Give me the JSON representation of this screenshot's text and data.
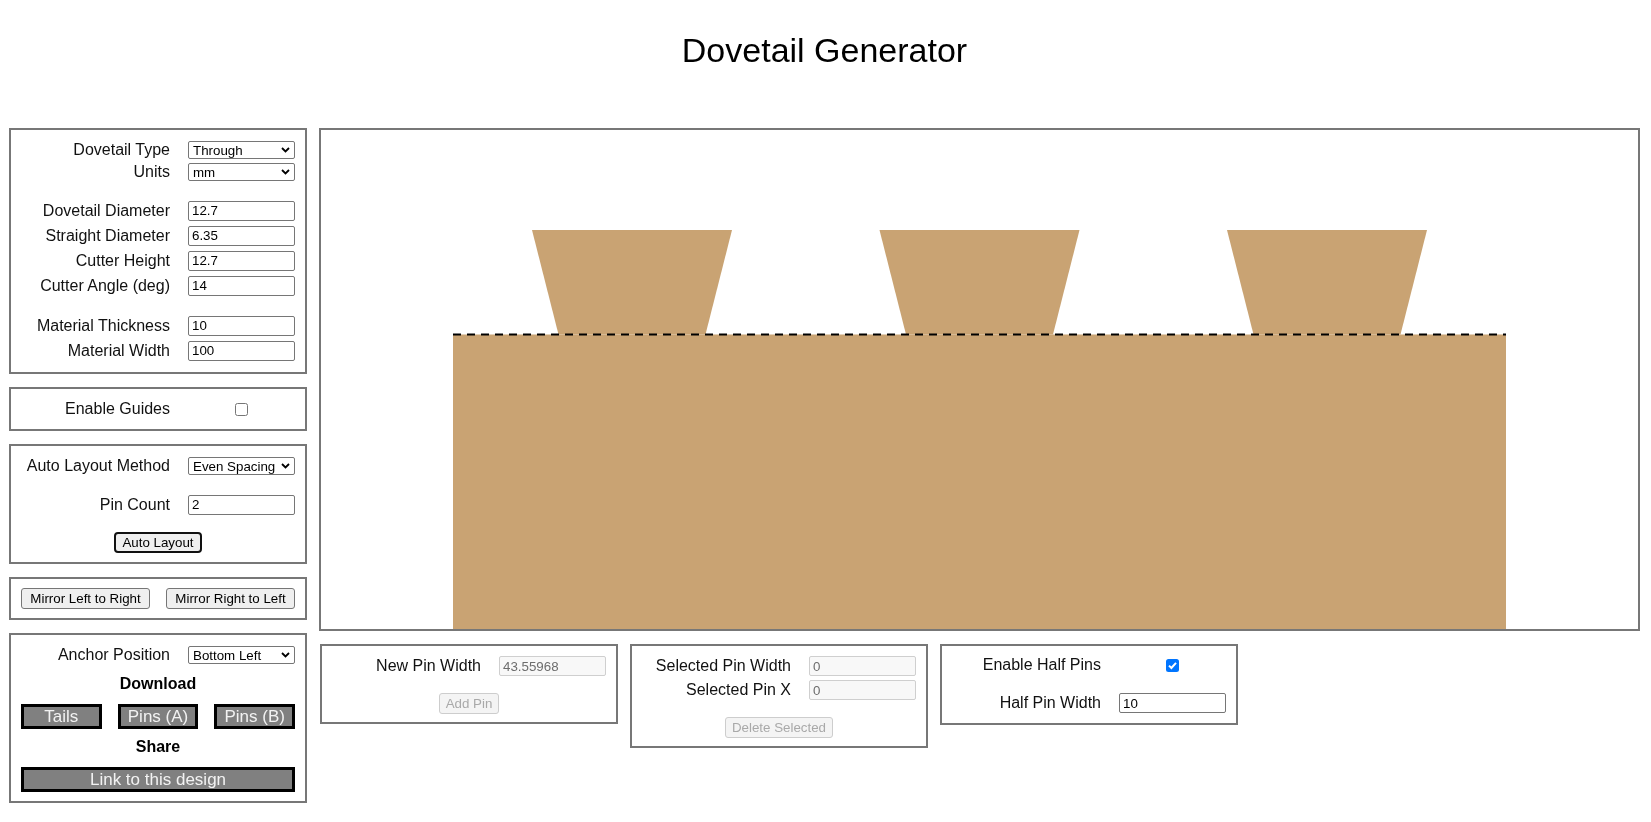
{
  "title": "Dovetail Generator",
  "sidebar": [
    {
      "groups": [
        [
          {
            "kind": "select",
            "label": "Dovetail Type",
            "value": "Through"
          },
          {
            "kind": "select",
            "label": "Units",
            "value": "mm"
          }
        ],
        [
          {
            "kind": "input",
            "label": "Dovetail Diameter",
            "value": "12.7",
            "disabled": false
          },
          {
            "kind": "input",
            "label": "Straight Diameter",
            "value": "6.35",
            "disabled": false
          },
          {
            "kind": "input",
            "label": "Cutter Height",
            "value": "12.7",
            "disabled": false
          },
          {
            "kind": "input",
            "label": "Cutter Angle (deg)",
            "value": "14",
            "disabled": false
          }
        ],
        [
          {
            "kind": "input",
            "label": "Material Thickness",
            "value": "10",
            "disabled": false
          },
          {
            "kind": "input",
            "label": "Material Width",
            "value": "100",
            "disabled": false
          }
        ]
      ]
    },
    {
      "groups": [
        [
          {
            "kind": "checkbox",
            "label": "Enable Guides",
            "checked": false
          }
        ]
      ]
    },
    {
      "groups": [
        [
          {
            "kind": "select",
            "label": "Auto Layout Method",
            "value": "Even Spacing"
          }
        ],
        [
          {
            "kind": "input",
            "label": "Pin Count",
            "value": "2",
            "disabled": false
          }
        ],
        [
          {
            "kind": "buttons",
            "buttons": [
              {
                "kind": "plain",
                "label": "Auto Layout",
                "disabled": false,
                "focused": true
              }
            ]
          }
        ]
      ]
    },
    {
      "groups": [
        [
          {
            "kind": "buttons",
            "buttons": [
              {
                "kind": "plain",
                "label": "Mirror Left to Right",
                "disabled": false,
                "focused": false
              },
              {
                "kind": "plain",
                "label": "Mirror Right to Left",
                "disabled": false,
                "focused": false
              }
            ]
          }
        ]
      ]
    },
    {
      "groups": [
        [
          {
            "kind": "select",
            "label": "Anchor Position",
            "value": "Bottom Left"
          },
          {
            "kind": "heading",
            "text": "Download"
          },
          {
            "kind": "buttons",
            "buttons": [
              {
                "kind": "dark",
                "label": "Tails"
              },
              {
                "kind": "dark",
                "label": "Pins (A)"
              },
              {
                "kind": "dark",
                "label": "Pins (B)"
              }
            ]
          },
          {
            "kind": "heading",
            "text": "Share"
          },
          {
            "kind": "buttons",
            "buttons": [
              {
                "kind": "dark",
                "label": "Link to this design"
              }
            ]
          }
        ]
      ]
    }
  ],
  "bottom_panels": [
    {
      "groups": [
        [
          {
            "kind": "input",
            "label": "New Pin Width",
            "value": "43.55968",
            "disabled": true
          }
        ],
        [
          {
            "kind": "buttons",
            "buttons": [
              {
                "kind": "plain",
                "label": "Add Pin",
                "disabled": true,
                "focused": false
              }
            ]
          }
        ]
      ]
    },
    {
      "groups": [
        [
          {
            "kind": "input",
            "label": "Selected Pin Width",
            "value": "0",
            "disabled": true
          },
          {
            "kind": "input",
            "label": "Selected Pin X",
            "value": "0",
            "disabled": true
          }
        ],
        [
          {
            "kind": "buttons",
            "buttons": [
              {
                "kind": "plain",
                "label": "Delete Selected",
                "disabled": true,
                "focused": false
              }
            ]
          }
        ]
      ]
    },
    {
      "groups": [
        [
          {
            "kind": "checkbox",
            "label": "Enable Half Pins",
            "checked": true
          }
        ],
        [
          {
            "kind": "input",
            "label": "Half Pin Width",
            "value": "10",
            "disabled": false
          }
        ]
      ]
    }
  ]
}
